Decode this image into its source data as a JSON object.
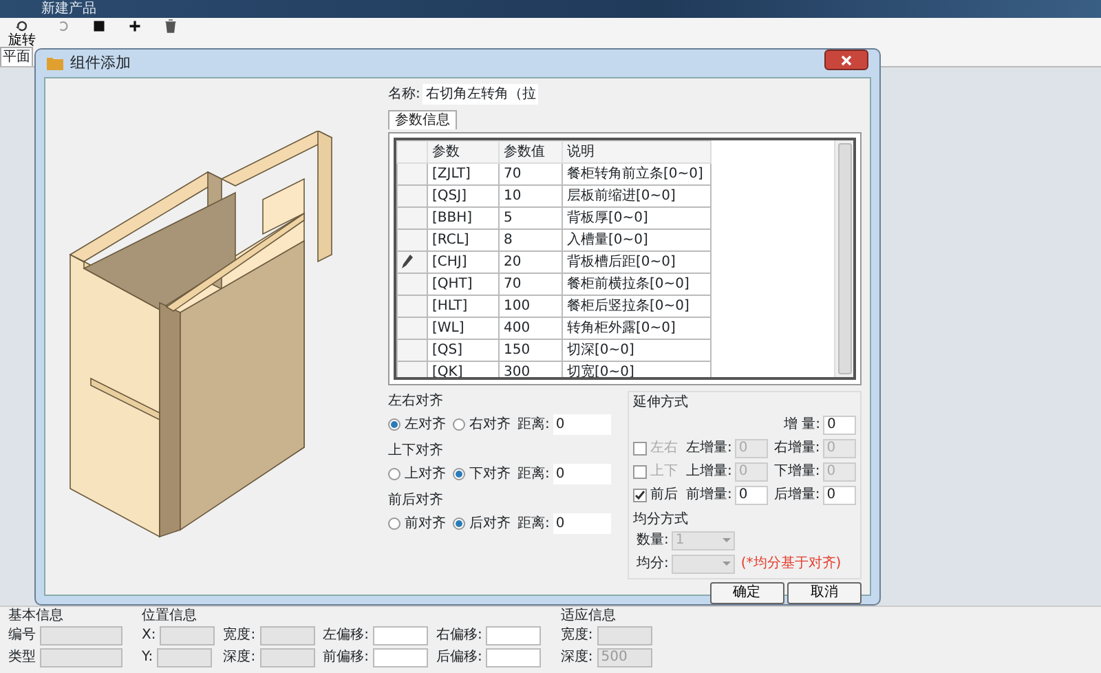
{
  "app": {
    "title": "新建产品",
    "toolbar": [
      {
        "kind": "rotate",
        "label": "旋转"
      },
      {
        "kind": "undo"
      },
      {
        "kind": "square"
      },
      {
        "kind": "plus"
      },
      {
        "kind": "trash"
      }
    ],
    "view_tab": "平面"
  },
  "dialog": {
    "title": "组件添加",
    "name_label": "名称:",
    "name_value": "右切角左转角（拉",
    "tabs": [
      {
        "label": "参数信息",
        "selected": true
      }
    ],
    "table": {
      "columns": [
        "参数",
        "参数值",
        "说明"
      ],
      "rows": [
        {
          "cells": [
            "[ZJLT]",
            "70",
            "餐柜转角前立条[0~0]"
          ],
          "editing": false
        },
        {
          "cells": [
            "[QSJ]",
            "10",
            "层板前缩进[0~0]"
          ],
          "editing": false
        },
        {
          "cells": [
            "[BBH]",
            "5",
            "背板厚[0~0]"
          ],
          "editing": false
        },
        {
          "cells": [
            "[RCL]",
            "8",
            "入槽量[0~0]"
          ],
          "editing": false
        },
        {
          "cells": [
            "[CHJ]",
            "20",
            "背板槽后距[0~0]"
          ],
          "editing": true
        },
        {
          "cells": [
            "[QHT]",
            "70",
            "餐柜前横拉条[0~0]"
          ],
          "editing": false
        },
        {
          "cells": [
            "[HLT]",
            "100",
            "餐柜后竖拉条[0~0]"
          ],
          "editing": false
        },
        {
          "cells": [
            "[WL]",
            "400",
            "转角柜外露[0~0]"
          ],
          "editing": false
        },
        {
          "cells": [
            "[QS]",
            "150",
            "切深[0~0]"
          ],
          "editing": false
        },
        {
          "cells": [
            "[QK]",
            "300",
            "切宽[0~0]"
          ],
          "editing": false
        }
      ]
    },
    "align_groups": [
      {
        "title": "左右对齐",
        "options": [
          {
            "label": "左对齐",
            "selected": true
          },
          {
            "label": "右对齐",
            "selected": false
          }
        ],
        "distance_label": "距离:",
        "distance": "0"
      },
      {
        "title": "上下对齐",
        "options": [
          {
            "label": "上对齐",
            "selected": false
          },
          {
            "label": "下对齐",
            "selected": true
          }
        ],
        "distance_label": "距离:",
        "distance": "0"
      },
      {
        "title": "前后对齐",
        "options": [
          {
            "label": "前对齐",
            "selected": false
          },
          {
            "label": "后对齐",
            "selected": true
          }
        ],
        "distance_label": "距离:",
        "distance": "0"
      }
    ],
    "extension": {
      "title": "延伸方式",
      "increment_label": "增 量:",
      "increment": "0",
      "rows": [
        {
          "label": "左右",
          "checked": false,
          "disabled": true,
          "fields": [
            {
              "label": "左增量:",
              "value": "0",
              "disabled": true
            },
            {
              "label": "右增量:",
              "value": "0",
              "disabled": true
            }
          ]
        },
        {
          "label": "上下",
          "checked": false,
          "disabled": true,
          "fields": [
            {
              "label": "上增量:",
              "value": "0",
              "disabled": true
            },
            {
              "label": "下增量:",
              "value": "0",
              "disabled": true
            }
          ]
        },
        {
          "label": "前后",
          "checked": true,
          "disabled": false,
          "fields": [
            {
              "label": "前增量:",
              "value": "0",
              "disabled": false
            },
            {
              "label": "后增量:",
              "value": "0",
              "disabled": false
            }
          ]
        }
      ]
    },
    "even_split": {
      "title": "均分方式",
      "fields": [
        {
          "label": "数量:",
          "value": "1",
          "disabled": true
        },
        {
          "label": "均分:",
          "disabled": true
        }
      ],
      "note": "(*均分基于对齐)"
    },
    "buttons": [
      "确定",
      "取消"
    ]
  },
  "bottom": [
    {
      "title": "基本信息",
      "fields": [
        {
          "label": "编号",
          "disabled": true
        },
        {
          "label": "类型",
          "disabled": true
        }
      ]
    },
    {
      "title": "位置信息",
      "fields": [
        {
          "label": "X:",
          "disabled": true
        },
        {
          "label": "宽度:",
          "disabled": true
        },
        {
          "label": "左偏移:",
          "disabled": false
        },
        {
          "label": "右偏移:",
          "disabled": false
        },
        {
          "label": "Y:",
          "disabled": true
        },
        {
          "label": "深度:",
          "disabled": true
        },
        {
          "label": "前偏移:",
          "disabled": false
        },
        {
          "label": "后偏移:",
          "disabled": false
        }
      ]
    },
    {
      "title": "适应信息",
      "fields": [
        {
          "label": "宽度:",
          "disabled": true
        },
        {
          "label": "深度:",
          "value": "500",
          "disabled": true
        }
      ]
    }
  ]
}
